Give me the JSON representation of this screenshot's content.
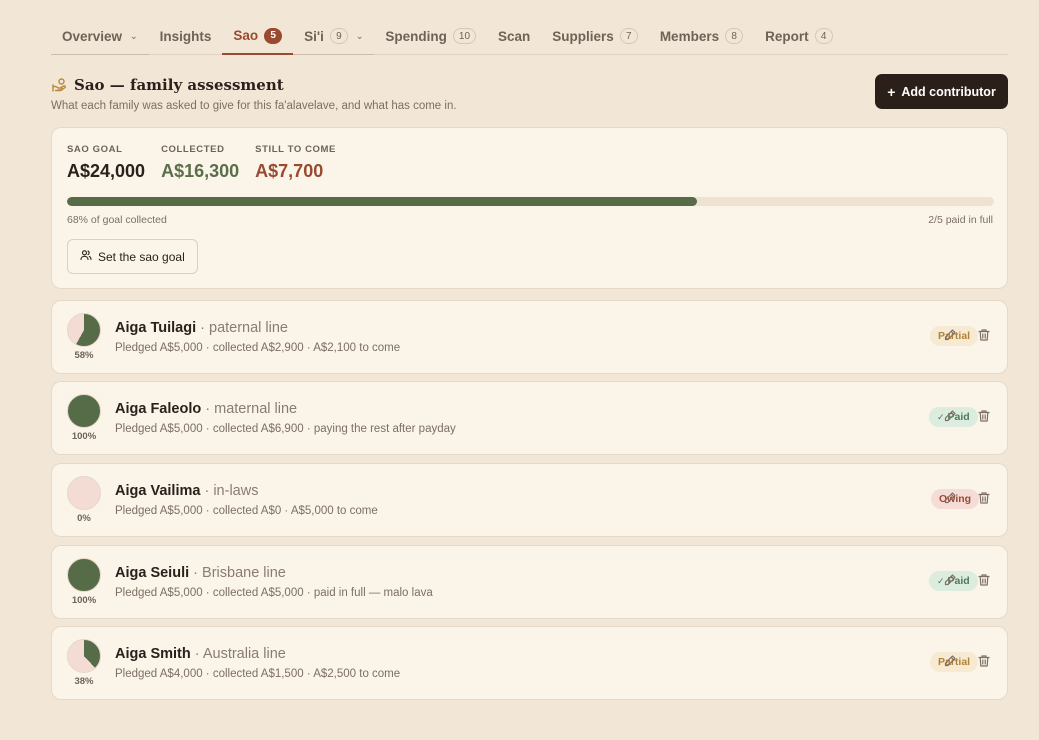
{
  "tabs": [
    {
      "label": "Overview",
      "badge": "",
      "chevron": true,
      "active": false
    },
    {
      "label": "Insights",
      "badge": "",
      "chevron": false,
      "active": false
    },
    {
      "label": "Sao",
      "badge": "5",
      "chevron": false,
      "active": true
    },
    {
      "label": "Si'i",
      "badge": "9",
      "chevron": true,
      "active": false
    },
    {
      "label": "Spending",
      "badge": "10",
      "chevron": false,
      "active": false
    },
    {
      "label": "Scan",
      "badge": "",
      "chevron": false,
      "active": false
    },
    {
      "label": "Suppliers",
      "badge": "7",
      "chevron": false,
      "active": false
    },
    {
      "label": "Members",
      "badge": "8",
      "chevron": false,
      "active": false
    },
    {
      "label": "Report",
      "badge": "4",
      "chevron": false,
      "active": false
    }
  ],
  "header": {
    "title": "Sao — family assessment",
    "subtitle": "What each family was asked to give for this fa'alavelave, and what has come in.",
    "add_button": "Add contributor",
    "add_plus": "+"
  },
  "summary": {
    "goal_label": "SAO GOAL",
    "goal_value": "A$24,000",
    "collected_label": "COLLECTED",
    "collected_value": "A$16,300",
    "tocome_label": "STILL TO COME",
    "tocome_value": "A$7,700",
    "progress_fraction": 0.68,
    "progress_text": "68% of goal collected",
    "paid_text": "2/5 paid in full",
    "set_goal_button": "Set the sao goal"
  },
  "colors": {
    "accent": "#9a4a30",
    "collected": "#566b47",
    "pie_empty": "#f3dcd4",
    "background": "#f2e6d6"
  },
  "contributors": [
    {
      "name": "Aiga Tuilagi",
      "line": "paternal line",
      "detail": "Pledged A$5,000 · collected A$2,900 · A$2,100 to come",
      "pct_label": "58%",
      "fraction": 0.58,
      "status": "Partial",
      "status_type": "partial",
      "status_check": ""
    },
    {
      "name": "Aiga Faleolo",
      "line": "maternal line",
      "detail": "Pledged A$5,000 · collected A$6,900 · paying the rest after payday",
      "pct_label": "100%",
      "fraction": 1.0,
      "status": "Paid",
      "status_type": "paid",
      "status_check": "✓"
    },
    {
      "name": "Aiga Vailima",
      "line": "in-laws",
      "detail": "Pledged A$5,000 · collected A$0 · A$5,000 to come",
      "pct_label": "0%",
      "fraction": 0.0,
      "status": "Owing",
      "status_type": "owing",
      "status_check": ""
    },
    {
      "name": "Aiga Seiuli",
      "line": "Brisbane line",
      "detail": "Pledged A$5,000 · collected A$5,000 · paid in full — malo lava",
      "pct_label": "100%",
      "fraction": 1.0,
      "status": "Paid",
      "status_type": "paid",
      "status_check": "✓"
    },
    {
      "name": "Aiga Smith",
      "line": "Australia line",
      "detail": "Pledged A$4,000 · collected A$1,500 · A$2,500 to come",
      "pct_label": "38%",
      "fraction": 0.38,
      "status": "Partial",
      "status_type": "partial",
      "status_check": ""
    }
  ]
}
